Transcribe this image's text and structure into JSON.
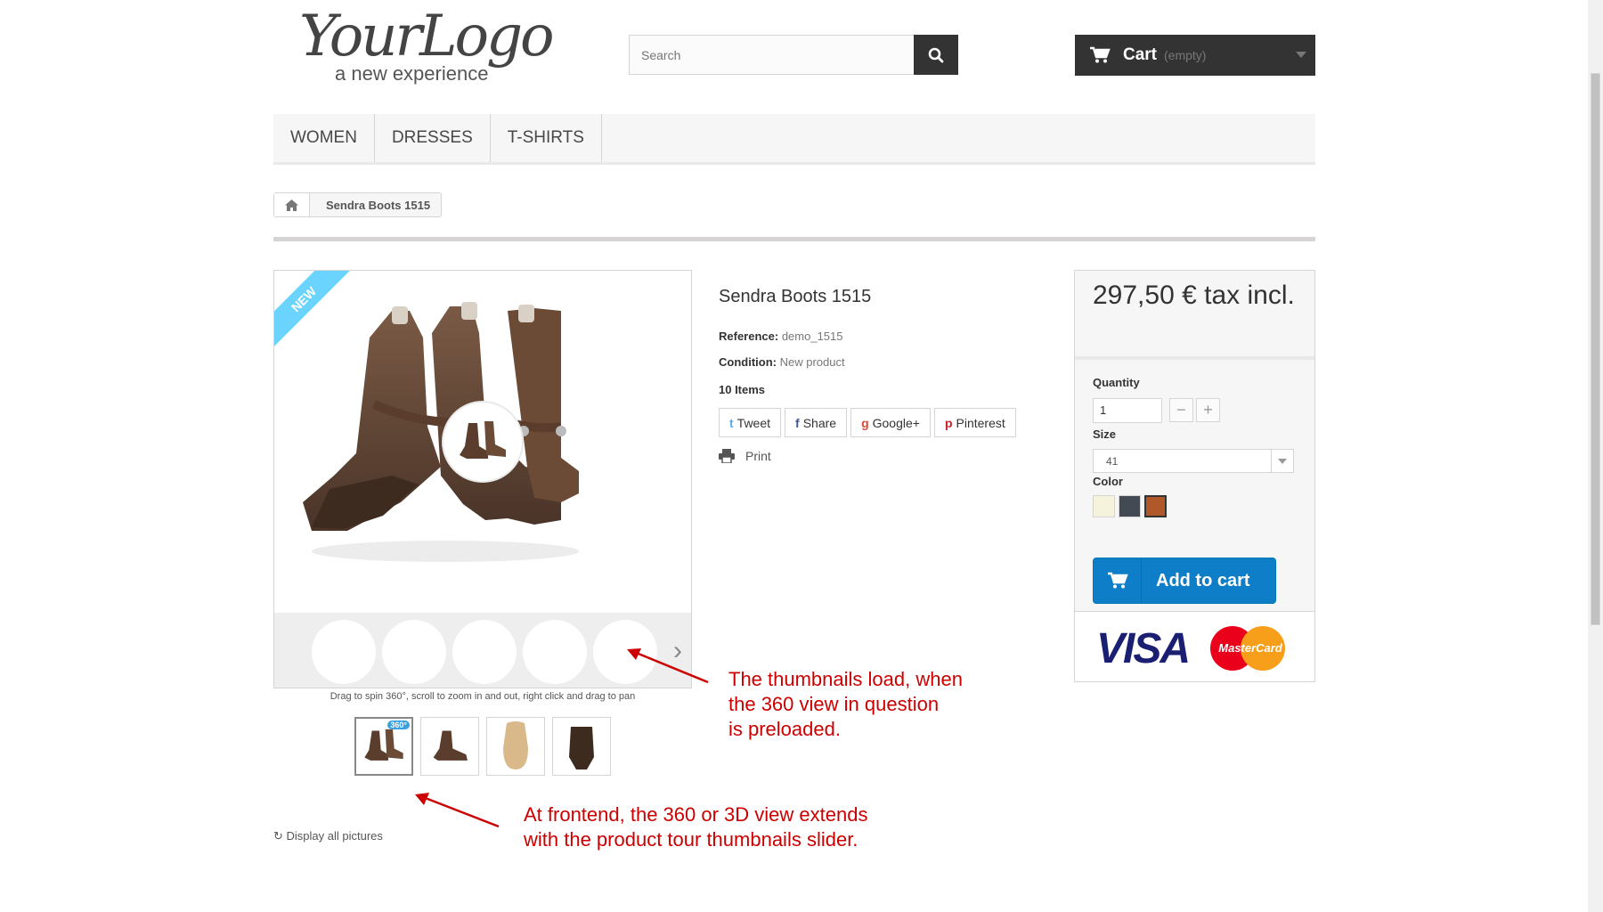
{
  "header": {
    "logo_main": "YourLogo",
    "logo_sub": "a new experience",
    "search_placeholder": "Search",
    "cart_label": "Cart",
    "cart_status": "(empty)"
  },
  "nav": {
    "items": [
      "WOMEN",
      "DRESSES",
      "T-SHIRTS"
    ]
  },
  "breadcrumb": {
    "current": "Sendra Boots 1515"
  },
  "viewer": {
    "ribbon": "NEW",
    "hint": "Drag to spin 360°, scroll to zoom in and out, right click and drag to pan",
    "thumb_badge": "360°",
    "display_all": "Display all pictures"
  },
  "product": {
    "name": "Sendra Boots 1515",
    "reference_label": "Reference:",
    "reference_value": "demo_1515",
    "condition_label": "Condition:",
    "condition_value": "New product",
    "items": "10 Items",
    "social": [
      "Tweet",
      "Share",
      "Google+",
      "Pinterest"
    ],
    "print": "Print"
  },
  "buybox": {
    "price": "297,50 € tax incl.",
    "quantity_label": "Quantity",
    "quantity_value": "1",
    "size_label": "Size",
    "size_value": "41",
    "color_label": "Color",
    "colors": [
      "#f5f3dc",
      "#434a54",
      "#b0582a"
    ],
    "add_to_cart": "Add to cart",
    "visa": "VISA",
    "mastercard": "MasterCard"
  },
  "annotations": {
    "note1": "The thumbnails load, when\nthe 360 view in question\nis preloaded.",
    "note2": "At frontend, the 360 or 3D view extends\nwith the product tour thumbnails slider."
  }
}
